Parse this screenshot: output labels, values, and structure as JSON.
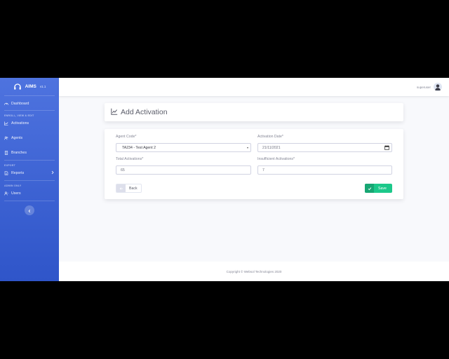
{
  "brand": {
    "name": "AIMS",
    "version": "v1.1"
  },
  "sidebar": {
    "dashboard": "Dashboard",
    "heading1": "ENROLL, VIEW & EDIT",
    "items1": [
      "Activations",
      "Agents",
      "Branches"
    ],
    "heading2": "EXPORT",
    "reports": "Reports",
    "heading3": "ADMIN ONLY",
    "users": "Users"
  },
  "topbar": {
    "username": "superuser"
  },
  "page": {
    "title": "Add Activation"
  },
  "form": {
    "agent_code_label": "Agent Code*",
    "agent_code_value": "TA234 - Test Agent 2",
    "activation_date_label": "Activation Date*",
    "activation_date_value": "21/11/2021",
    "total_label": "Total Activations*",
    "total_value": "65",
    "insufficient_label": "Insufficient Activations*",
    "insufficient_value": "7",
    "back_label": "Back",
    "save_label": "Save"
  },
  "footer": {
    "text": "Copyright © Websol Technologies 2020"
  },
  "colors": {
    "primary": "#4e73df",
    "success": "#1cc88a",
    "background": "#f8f9fc"
  },
  "icons": [
    "headset-icon",
    "tachometer-icon",
    "chart-line-icon",
    "users-icon",
    "building-icon",
    "file-icon",
    "chevron-right-icon",
    "user-icon",
    "chevron-left-icon",
    "calendar-icon",
    "arrow-left-icon",
    "check-icon"
  ]
}
